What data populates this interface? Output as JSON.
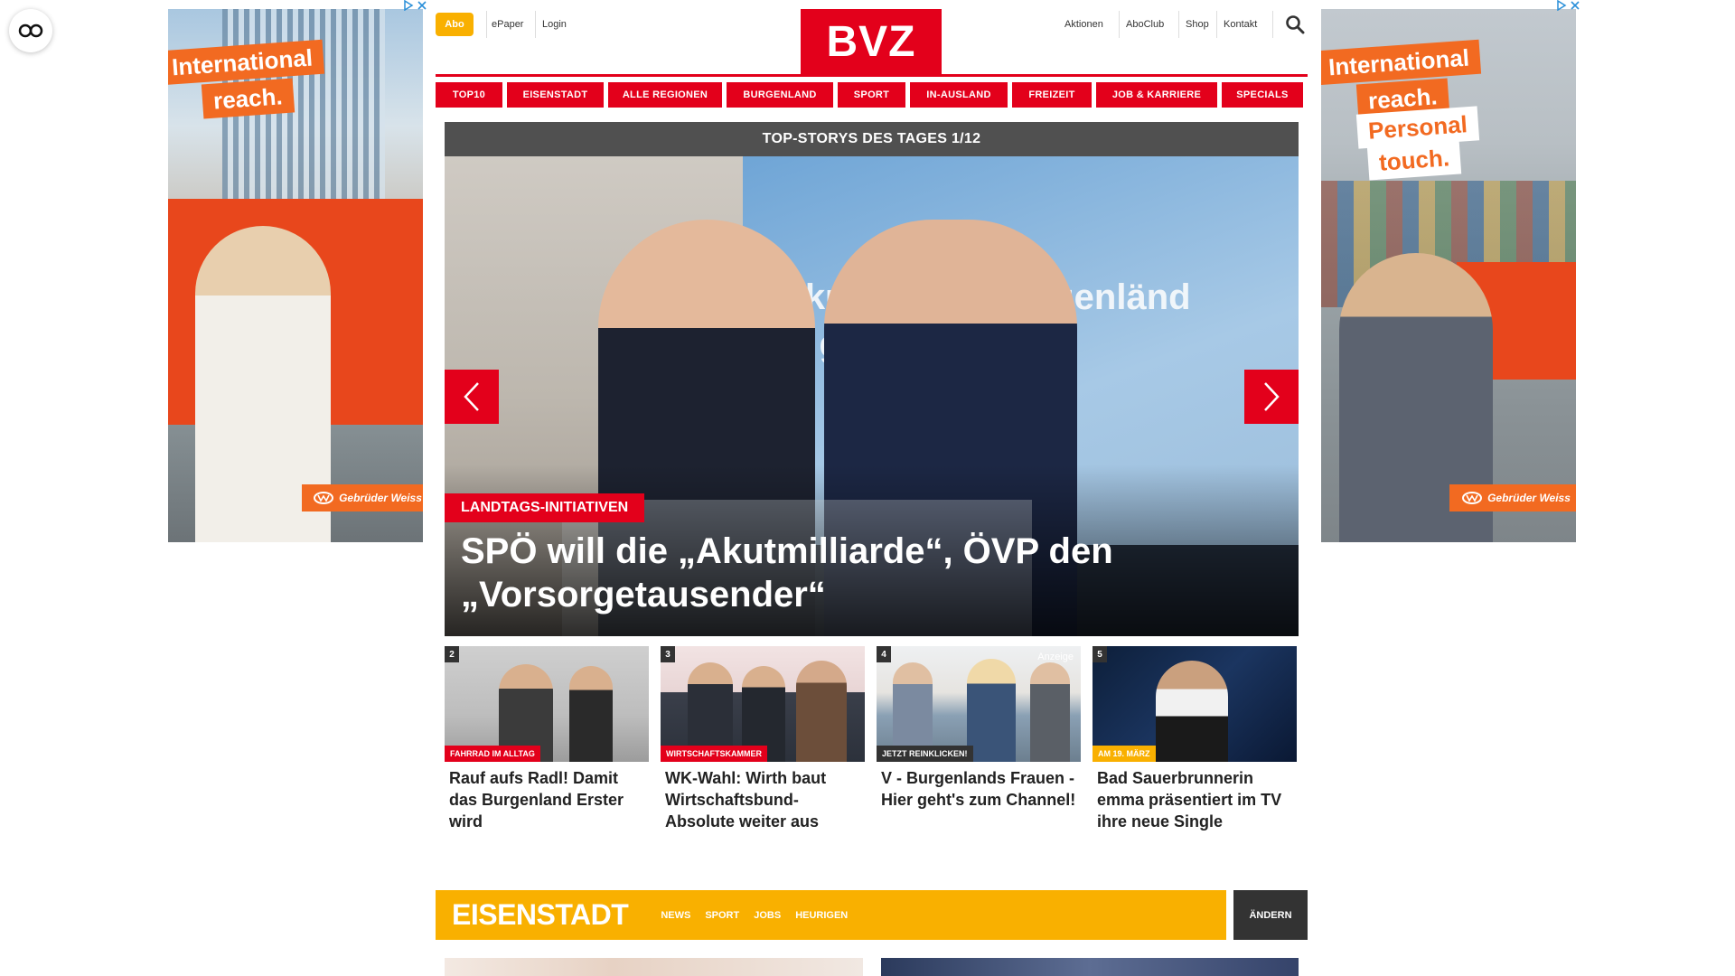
{
  "accessibility": {
    "icon": "glasses-icon"
  },
  "ads": {
    "left": {
      "tag1": "International",
      "tag2": "reach.",
      "brand": "Gebrüder Weiss"
    },
    "right": {
      "tag1": "International",
      "tag2": "reach.",
      "tag3": "Personal",
      "tag4": "touch.",
      "brand": "Gebrüder Weiss"
    }
  },
  "header": {
    "abo": "Abo",
    "epaper": "ePaper",
    "login": "Login",
    "logo": "BVZ",
    "right_links": [
      "Aktionen",
      "AboClub",
      "Shop",
      "Kontakt"
    ]
  },
  "nav": [
    "TOP10",
    "EISENSTADT",
    "ALLE REGIONEN",
    "BURGENLAND",
    "SPORT",
    "IN-AUSLAND",
    "FREIZEIT",
    "JOB & KARRIERE",
    "SPECIALS"
  ],
  "slider": {
    "header": "TOP-STORYS DES TAGES 1/12",
    "screen_text_line1": "Akutr      de für burgenländ",
    "screen_text_line2": "ei      gefordert!",
    "kicker": "LANDTAGS-INITIATIVEN",
    "title": "SPÖ will die „Akutmilliarde“, ÖVP den „Vorsorgetausender“"
  },
  "teasers": [
    {
      "num": "2",
      "kicker": "FAHRRAD IM ALLTAG",
      "title": "Rauf aufs Radl! Damit das Burgenland Erster wird",
      "color": "#e3001b"
    },
    {
      "num": "3",
      "kicker": "WIRTSCHAFTSKAMMER",
      "title": "WK-Wahl: Wirth baut Wirtschaftsbund-Absolute weiter aus",
      "color": "#e3001b"
    },
    {
      "num": "4",
      "kicker": "JETZT REINKLICKEN!",
      "title": "V - Burgenlands Frauen - Hier geht's zum Channel!",
      "color": "#333333",
      "ad": "Anzeige"
    },
    {
      "num": "5",
      "kicker": "AM 19. MÄRZ",
      "title": "Bad Sauerbrunnerin emma präsentiert im TV ihre neue Single",
      "color": "#f9b000"
    }
  ],
  "region": {
    "title": "EISENSTADT",
    "links": [
      "NEWS",
      "SPORT",
      "JOBS",
      "HEURIGEN"
    ],
    "change": "ÄNDERN"
  },
  "colors": {
    "brand_red": "#e3001b",
    "accent_yellow": "#f9b000",
    "dark": "#333333"
  }
}
